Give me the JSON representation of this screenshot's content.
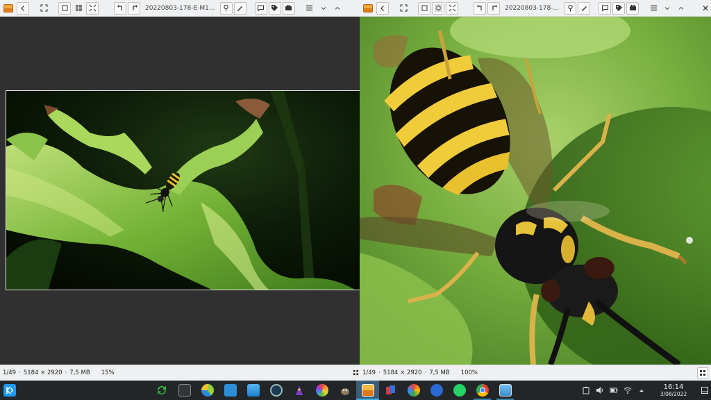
{
  "left_window": {
    "title": "20220803-178-E-M1...",
    "status": {
      "index": "1/49",
      "dimensions": "5184 × 2920",
      "size": "7,5 MB",
      "zoom": "15%"
    }
  },
  "right_window": {
    "title": "20220803-178-...",
    "status": {
      "index": "1/49",
      "dimensions": "5184 × 2920",
      "size": "7,5 MB",
      "zoom": "100%"
    }
  },
  "separator": "·",
  "taskbar": {
    "apps": [
      "refresh-app",
      "konsole",
      "krita",
      "discover",
      "dolphin",
      "clock-app",
      "wizard-app",
      "photo-app",
      "gimp",
      "gwenview",
      "cards-app",
      "color-app",
      "thunderbird",
      "whatsapp",
      "chrome",
      "image-viewer"
    ],
    "clock": {
      "time": "16:14",
      "date": "3/08/2022"
    }
  },
  "colors": {
    "accent": "#3daee9",
    "toolbar_bg": "#eff0f1",
    "taskbar_bg": "#232629",
    "viewer_bg": "#303030"
  }
}
